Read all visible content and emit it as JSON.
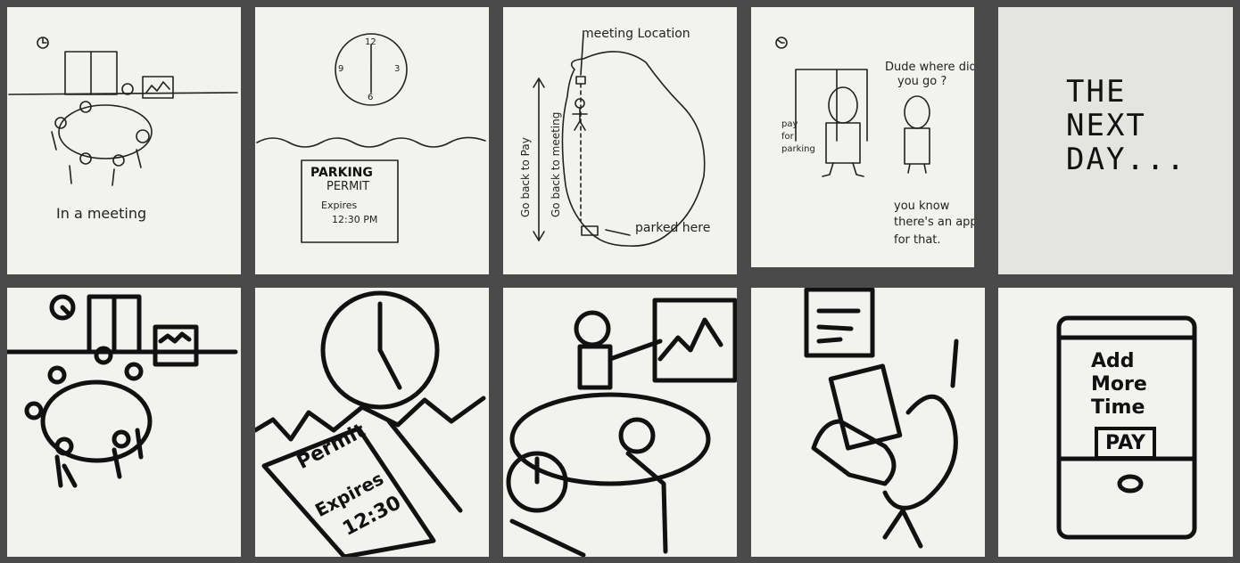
{
  "storyboard": {
    "row1": {
      "panel1": {
        "caption": "In a meeting"
      },
      "panel2": {
        "clock_12": "12",
        "clock_3": "3",
        "clock_6": "6",
        "clock_9": "9",
        "permit_line1": "PARKING",
        "permit_line2": "PERMIT",
        "permit_line3": "Expires",
        "permit_line4": "12:30 PM"
      },
      "panel3": {
        "top_label": "meeting Location",
        "left_label_1": "Go back to Pay",
        "left_label_2": "Go back to meeting",
        "bottom_label": "parked here"
      },
      "panel4": {
        "speech_1a": "Dude where did",
        "speech_1b": "you go ?",
        "side_1": "pay",
        "side_2": "for",
        "side_3": "parking",
        "speech_2a": "you know",
        "speech_2b": "there's an app",
        "speech_2c": "for that."
      },
      "panel5": {
        "line1": "THE",
        "line2": "NEXT",
        "line3": "DAY..."
      }
    },
    "row2": {
      "panel7": {
        "permit_title": "Permit",
        "permit_expires": "Expires",
        "permit_time": "12:30"
      },
      "panel10": {
        "line1": "Add",
        "line2": "More",
        "line3": "Time",
        "button": "PAY"
      }
    }
  }
}
